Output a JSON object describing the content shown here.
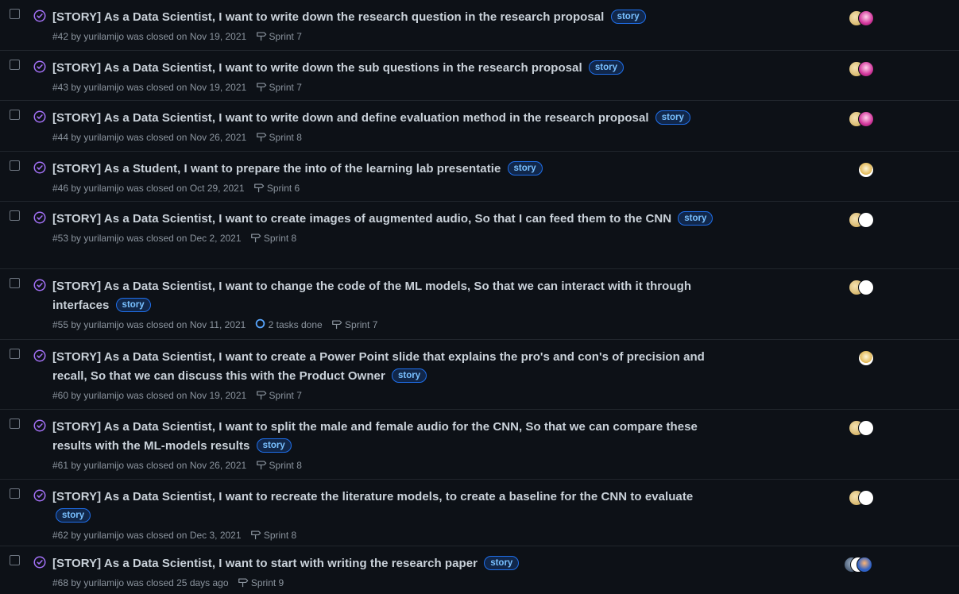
{
  "colors": {
    "background": "#0d1117",
    "closed_icon": "#a371f7",
    "label_border": "#1f6feb",
    "label_text": "#79c0ff",
    "tasks_ring": "#58a6ff"
  },
  "icons": {
    "state": "issue-closed-icon",
    "milestone": "milestone-icon",
    "tasks": "tasks-progress-icon"
  },
  "issues": [
    {
      "title": "[STORY] As a Data Scientist, I want to write down the research question in the research proposal",
      "label": "story",
      "number": "#42",
      "by": "by",
      "author": "yurilamijo",
      "closed": "was closed on Nov 19, 2021",
      "tasks": "",
      "milestone": "Sprint 7",
      "avatars": [
        "gold",
        "pink"
      ]
    },
    {
      "title": "[STORY] As a Data Scientist, I want to write down the sub questions in the research proposal",
      "label": "story",
      "number": "#43",
      "by": "by",
      "author": "yurilamijo",
      "closed": "was closed on Nov 19, 2021",
      "tasks": "",
      "milestone": "Sprint 7",
      "avatars": [
        "gold",
        "pink"
      ]
    },
    {
      "title": "[STORY] As a Data Scientist, I want to write down and define evaluation method in the research proposal",
      "label": "story",
      "number": "#44",
      "by": "by",
      "author": "yurilamijo",
      "closed": "was closed on Nov 26, 2021",
      "tasks": "",
      "milestone": "Sprint 8",
      "avatars": [
        "gold",
        "pink"
      ]
    },
    {
      "title": "[STORY] As a Student, I want to prepare the into of the learning lab presentatie",
      "label": "story",
      "number": "#46",
      "by": "by",
      "author": "yurilamijo",
      "closed": "was closed on Oct 29, 2021",
      "tasks": "",
      "milestone": "Sprint 6",
      "avatars": [
        "tan"
      ]
    },
    {
      "title": "[STORY] As a Data Scientist, I want to create images of augmented audio, So that I can feed them to the CNN",
      "label": "story",
      "number": "#53",
      "by": "by",
      "author": "yurilamijo",
      "closed": "was closed on Dec 2, 2021",
      "tasks": "",
      "milestone": "Sprint 8",
      "avatars": [
        "gold",
        "white"
      ]
    },
    {
      "title": "[STORY] As a Data Scientist, I want to change the code of the ML models, So that we can interact with it through interfaces",
      "label": "story",
      "number": "#55",
      "by": "by",
      "author": "yurilamijo",
      "closed": "was closed on Nov 11, 2021",
      "tasks": "2 tasks done",
      "milestone": "Sprint 7",
      "avatars": [
        "gold",
        "white"
      ]
    },
    {
      "title": "[STORY] As a Data Scientist, I want to create a Power Point slide that explains the pro's and con's of precision and recall, So that we can discuss this with the Product Owner",
      "label": "story",
      "number": "#60",
      "by": "by",
      "author": "yurilamijo",
      "closed": "was closed on Nov 19, 2021",
      "tasks": "",
      "milestone": "Sprint 7",
      "avatars": [
        "tan"
      ]
    },
    {
      "title": "[STORY] As a Data Scientist, I want to split the male and female audio for the CNN, So that we can compare these results with the ML-models results",
      "label": "story",
      "number": "#61",
      "by": "by",
      "author": "yurilamijo",
      "closed": "was closed on Nov 26, 2021",
      "tasks": "",
      "milestone": "Sprint 8",
      "avatars": [
        "gold",
        "white"
      ]
    },
    {
      "title": "[STORY] As a Data Scientist, I want to recreate the literature models, to create a baseline for the CNN to evaluate",
      "label": "story",
      "number": "#62",
      "by": "by",
      "author": "yurilamijo",
      "closed": "was closed on Dec 3, 2021",
      "tasks": "",
      "milestone": "Sprint 8",
      "avatars": [
        "gold",
        "white"
      ]
    },
    {
      "title": "[STORY] As a Data Scientist, I want to start with writing the research paper",
      "label": "story",
      "number": "#68",
      "by": "by",
      "author": "yurilamijo",
      "closed": "was closed 25 days ago",
      "tasks": "",
      "milestone": "Sprint 9",
      "avatars": [
        "dark",
        "white",
        "blue"
      ]
    }
  ]
}
